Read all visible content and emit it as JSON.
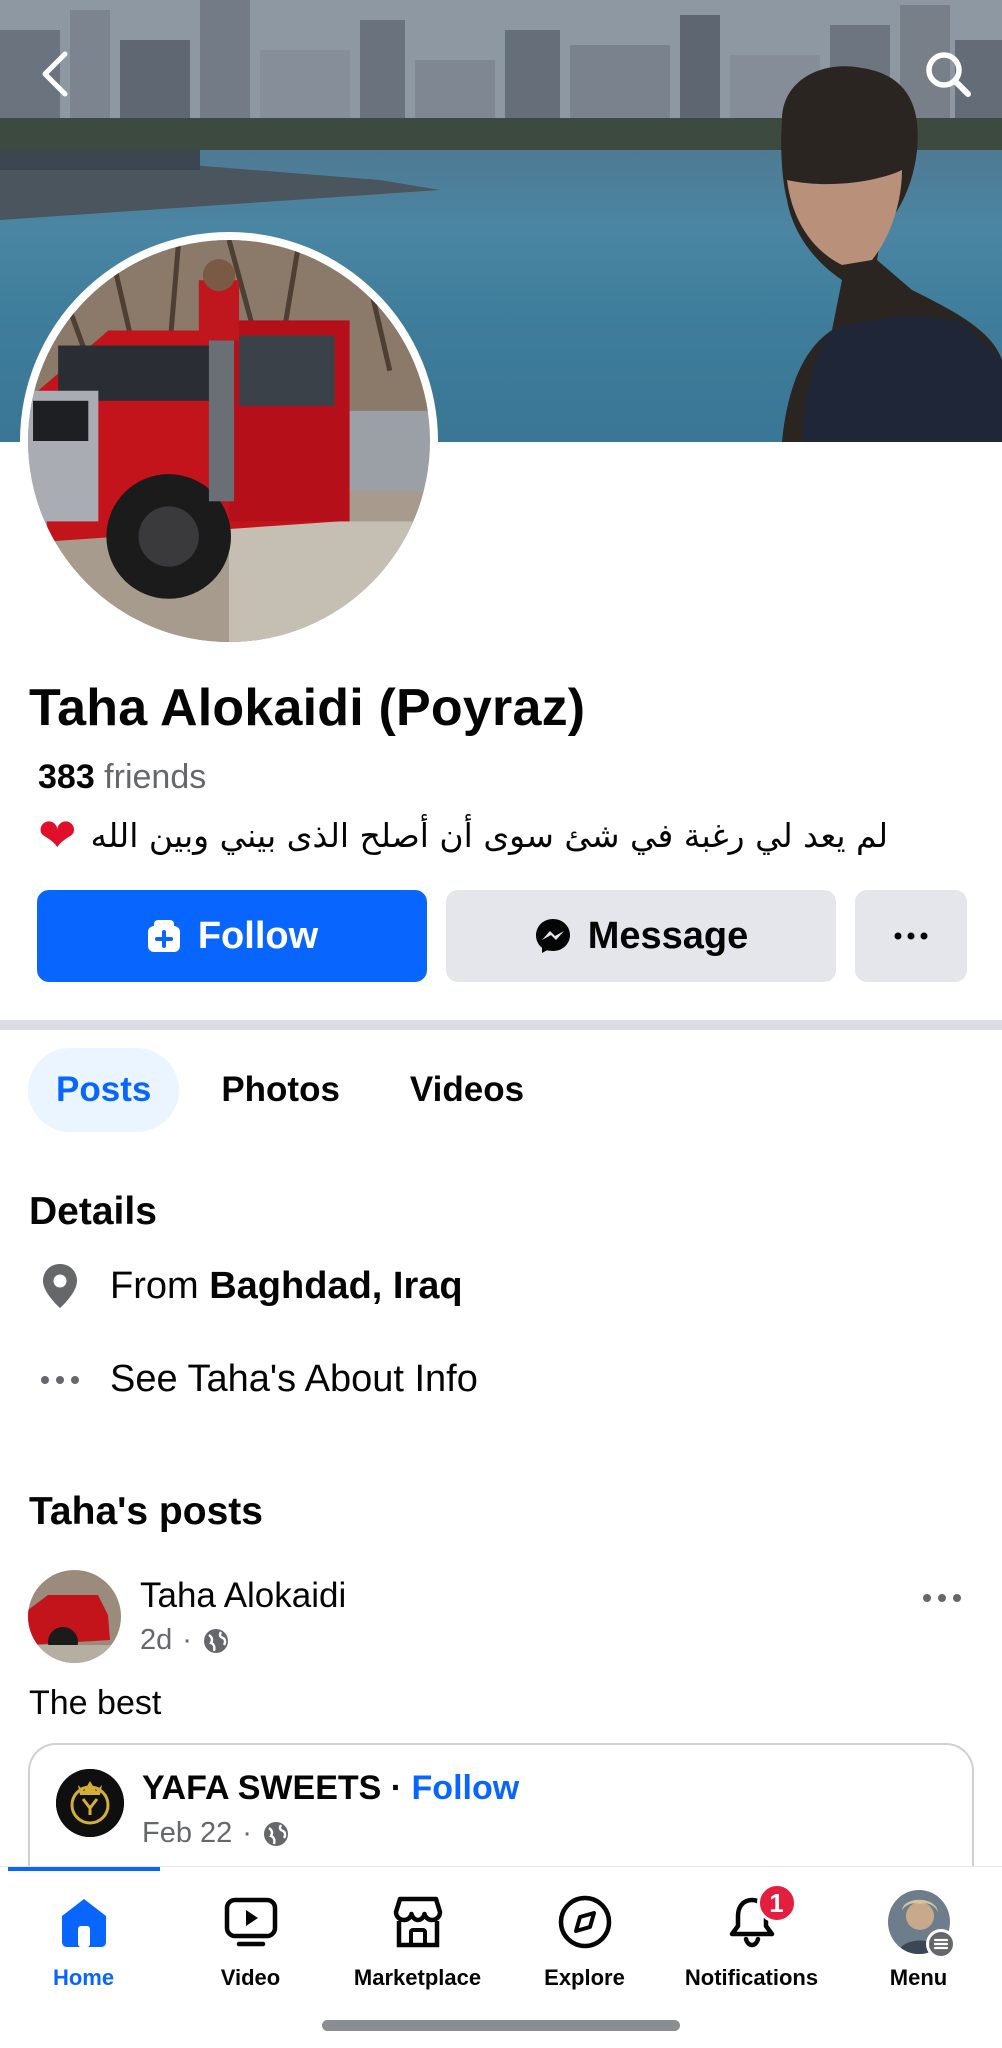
{
  "profile": {
    "name": "Taha Alokaidi (Poyraz)",
    "friends_count": "383",
    "friends_label": " friends",
    "bio": "لم يعد لي رغبة في شئ سوى أن أصلح الذى بيني وبين الله",
    "bio_emoji": "❤"
  },
  "actions": {
    "follow_label": "Follow",
    "message_label": "Message"
  },
  "tabs": [
    {
      "label": "Posts",
      "active": true
    },
    {
      "label": "Photos",
      "active": false
    },
    {
      "label": "Videos",
      "active": false
    }
  ],
  "details": {
    "heading": "Details",
    "from_prefix": "From ",
    "from_location": "Baghdad, Iraq",
    "about_link": "See Taha's About Info"
  },
  "posts": {
    "heading": "Taha's posts",
    "author": "Taha Alokaidi",
    "time": "2d",
    "text": "The best",
    "shared": {
      "page_name": "YAFA SWEETS",
      "separator": " · ",
      "follow_label": "Follow",
      "date": "Feb 22"
    }
  },
  "nav": {
    "items": [
      {
        "label": "Home",
        "icon": "home-icon",
        "active": true
      },
      {
        "label": "Video",
        "icon": "video-icon",
        "active": false
      },
      {
        "label": "Marketplace",
        "icon": "marketplace-icon",
        "active": false
      },
      {
        "label": "Explore",
        "icon": "compass-icon",
        "active": false
      },
      {
        "label": "Notifications",
        "icon": "bell-icon",
        "active": false,
        "badge": "1"
      },
      {
        "label": "Menu",
        "icon": "menu-avatar",
        "active": false
      }
    ]
  },
  "colors": {
    "accent": "#0866ff",
    "badge": "#e41e3f",
    "secondary_button": "#e4e6eb"
  }
}
